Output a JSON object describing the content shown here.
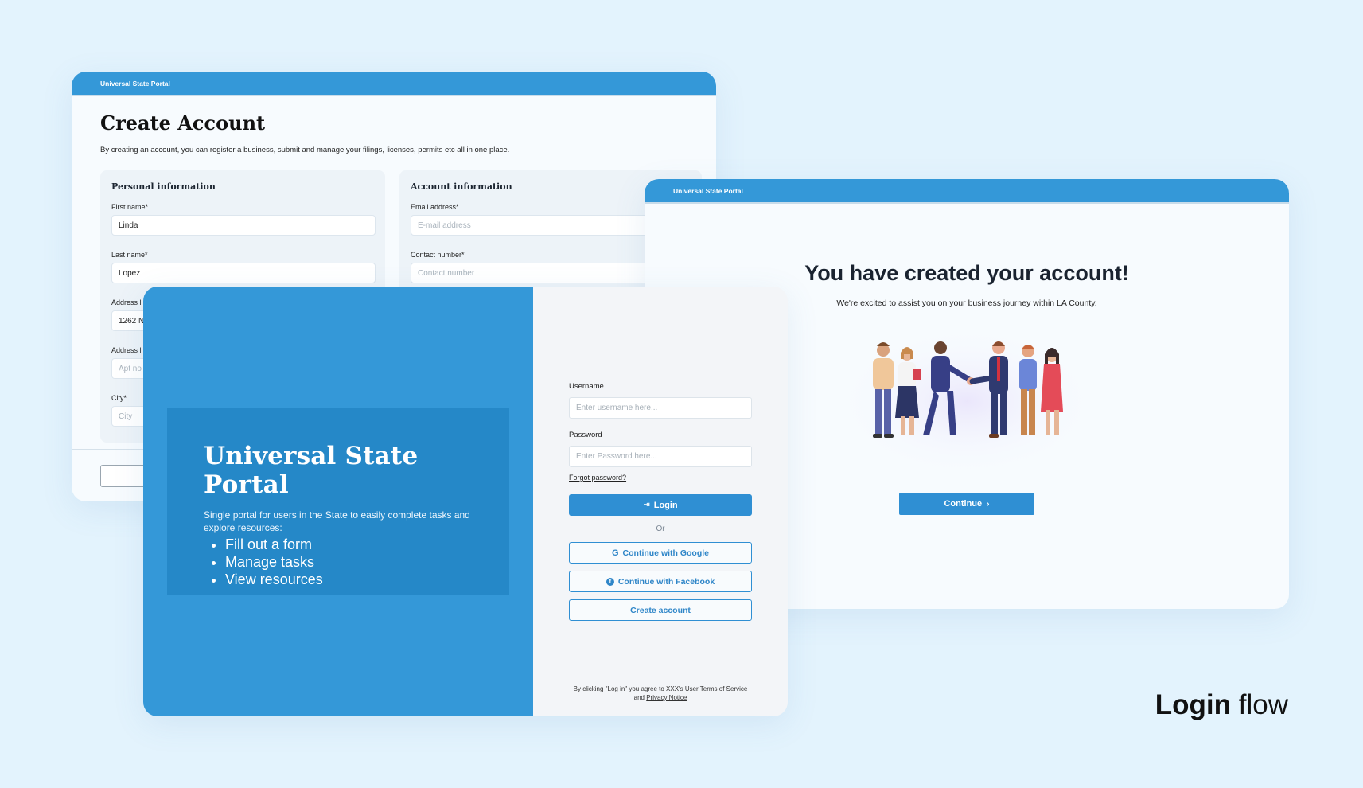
{
  "create_account": {
    "header": "Universal State Portal",
    "title": "Create Account",
    "description": "By creating an account, you can register a business, submit and manage your filings, licenses, permits etc all in one place.",
    "personal": {
      "title": "Personal information",
      "first_name_label": "First name*",
      "first_name_value": "Linda",
      "last_name_label": "Last name*",
      "last_name_value": "Lopez",
      "address1_label": "Address l",
      "address1_value": "1262 N",
      "address2_label": "Address l",
      "address2_placeholder": "Apt no",
      "city_label": "City*",
      "city_placeholder": "City"
    },
    "account": {
      "title": "Account information",
      "email_label": "Email address*",
      "email_placeholder": "E-mail address",
      "contact_label": "Contact number*",
      "contact_placeholder": "Contact number"
    }
  },
  "success": {
    "header": "Universal State Portal",
    "title": "You have created your account!",
    "subtitle": "We're excited to assist you on your business journey within LA County.",
    "continue_label": "Continue",
    "continue_icon": "chevron-right-icon"
  },
  "login": {
    "hero_title": "Universal State Portal",
    "hero_desc": "Single portal for users in the State to easily complete tasks and explore resources:",
    "hero_items": [
      "Fill out a form",
      "Manage tasks",
      "View resources"
    ],
    "username_label": "Username",
    "username_placeholder": "Enter username here...",
    "password_label": "Password",
    "password_placeholder": "Enter Password here...",
    "forgot_label": "Forgot password?",
    "login_label": "Login",
    "or_label": "Or",
    "google_label": "Continue with Google",
    "facebook_label": "Continue with Facebook",
    "create_label": "Create account",
    "terms_prefix": "By clicking \"Log in\" you agree to XXX's ",
    "terms_link1": "User Terms of Service",
    "terms_and": " and ",
    "terms_link2": "Privacy Notice"
  },
  "caption": {
    "bold": "Login",
    "light": " flow"
  },
  "colors": {
    "background": "#e3f3fd",
    "primary": "#3498d8",
    "primary_dark": "#2588c8",
    "button": "#2f8fd3"
  }
}
